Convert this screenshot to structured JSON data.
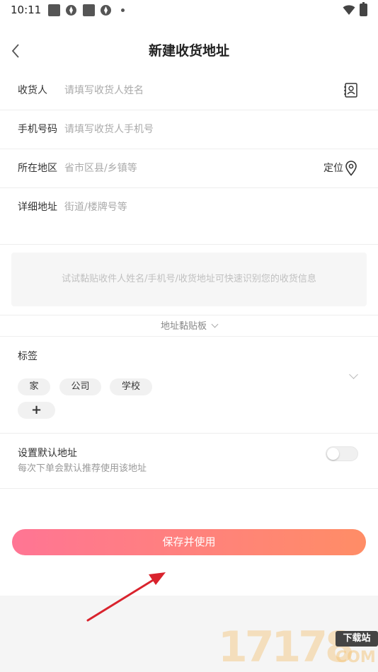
{
  "status_bar": {
    "time": "10:11"
  },
  "header": {
    "title": "新建收货地址"
  },
  "form": {
    "recipient": {
      "label": "收货人",
      "placeholder": "请填写收货人姓名"
    },
    "phone": {
      "label": "手机号码",
      "placeholder": "请填写收货人手机号"
    },
    "region": {
      "label": "所在地区",
      "placeholder": "省市区县/乡镇等",
      "locate_label": "定位"
    },
    "detail": {
      "label": "详细地址",
      "placeholder": "街道/楼牌号等"
    }
  },
  "paste": {
    "hint": "试试黏贴收件人姓名/手机号/收货地址可快速识别您的收货信息",
    "clipboard_label": "地址黏贴板"
  },
  "tags": {
    "title": "标签",
    "items": [
      "家",
      "公司",
      "学校"
    ],
    "add_label": "+"
  },
  "default_address": {
    "title": "设置默认地址",
    "subtitle": "每次下单会默认推荐使用该地址",
    "enabled": false
  },
  "save_button": {
    "label": "保存并使用",
    "gradient": [
      "#ff7594",
      "#ff8d66"
    ]
  },
  "watermark": {
    "digits": "17178",
    "badge": "下载站",
    "suffix": "COM"
  },
  "colors": {
    "arrow": "#d9232d",
    "placeholder": "#aaaaaa"
  }
}
